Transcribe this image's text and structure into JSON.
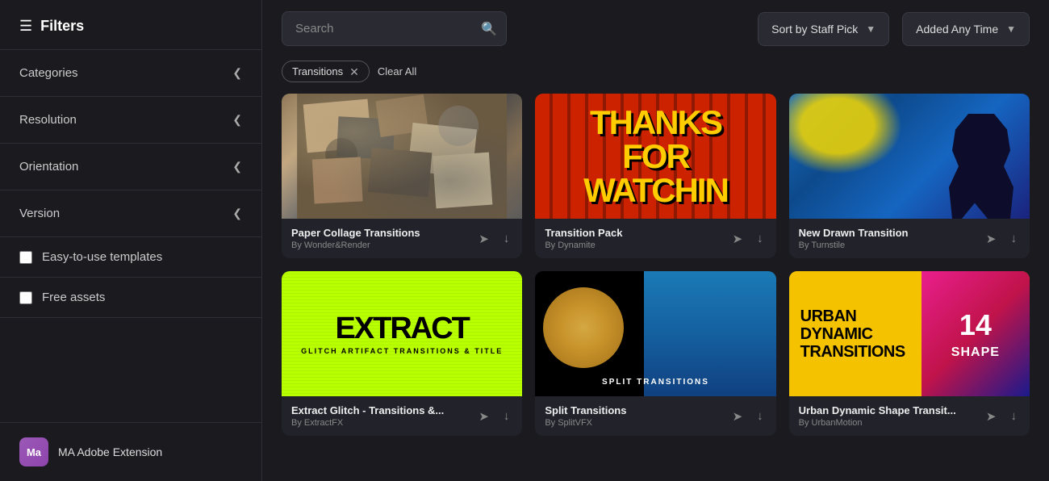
{
  "sidebar": {
    "title": "Filters",
    "sections": [
      {
        "id": "categories",
        "label": "Categories"
      },
      {
        "id": "resolution",
        "label": "Resolution"
      },
      {
        "id": "orientation",
        "label": "Orientation"
      },
      {
        "id": "version",
        "label": "Version"
      }
    ],
    "checkboxes": [
      {
        "id": "easy-use",
        "label": "Easy-to-use templates",
        "checked": false
      },
      {
        "id": "free-assets",
        "label": "Free assets",
        "checked": false
      }
    ],
    "extension": {
      "initials": "Ma",
      "label": "MA Adobe Extension"
    }
  },
  "topbar": {
    "search_placeholder": "Search",
    "sort_label": "Sort by Staff Pick",
    "added_label": "Added Any Time"
  },
  "filter_tags": [
    {
      "id": "transitions",
      "label": "Transitions"
    }
  ],
  "clear_all_label": "Clear All",
  "cards": [
    {
      "id": "paper-collage",
      "title": "Paper Collage Transitions",
      "author": "By Wonder&Render",
      "thumb_type": "paper-collage"
    },
    {
      "id": "transition-pack",
      "title": "Transition Pack",
      "author": "By Dynamite",
      "thumb_type": "transition-pack"
    },
    {
      "id": "new-drawn",
      "title": "New Drawn Transition",
      "author": "By Turnstile",
      "thumb_type": "new-drawn"
    },
    {
      "id": "extract-glitch",
      "title": "Extract Glitch - Transitions &...",
      "author": "By ExtractFX",
      "thumb_type": "extract-glitch"
    },
    {
      "id": "split-transitions",
      "title": "Split Transitions",
      "author": "By SplitVFX",
      "thumb_type": "split-transitions"
    },
    {
      "id": "urban-dynamic",
      "title": "Urban Dynamic Shape Transit...",
      "author": "By UrbanMotion",
      "thumb_type": "urban-dynamic"
    }
  ]
}
